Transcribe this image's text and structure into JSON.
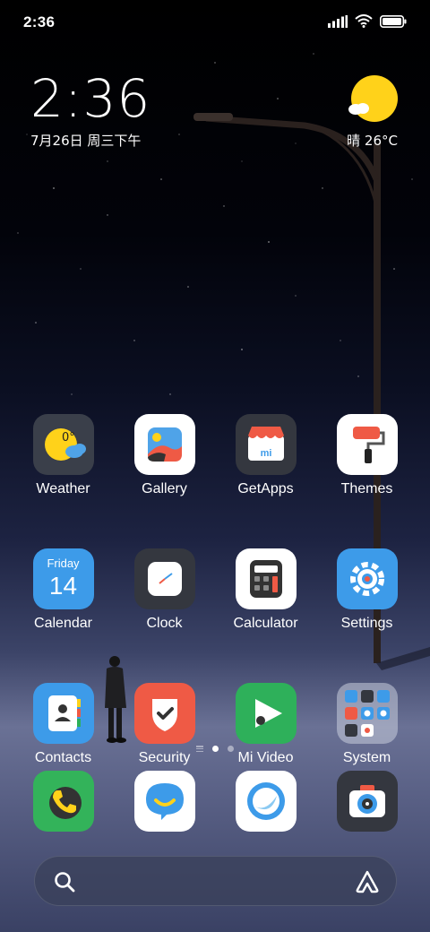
{
  "status_bar": {
    "time": "2:36"
  },
  "clock_widget": {
    "time": "2:36",
    "date": "7月26日 周三下午"
  },
  "weather_widget": {
    "text": "晴 26°C",
    "sun_color": "#ffd21a"
  },
  "apps": [
    {
      "id": "weather",
      "label": "Weather",
      "icon": "weather-icon",
      "badge_text": "0°"
    },
    {
      "id": "gallery",
      "label": "Gallery",
      "icon": "gallery-icon"
    },
    {
      "id": "getapps",
      "label": "GetApps",
      "icon": "getapps-icon",
      "badge_text": "mi"
    },
    {
      "id": "themes",
      "label": "Themes",
      "icon": "themes-icon"
    },
    {
      "id": "calendar",
      "label": "Calendar",
      "icon": "calendar-icon",
      "day_name": "Friday",
      "day_number": "14"
    },
    {
      "id": "clock",
      "label": "Clock",
      "icon": "clock-icon"
    },
    {
      "id": "calculator",
      "label": "Calculator",
      "icon": "calculator-icon"
    },
    {
      "id": "settings",
      "label": "Settings",
      "icon": "settings-icon"
    },
    {
      "id": "contacts",
      "label": "Contacts",
      "icon": "contacts-icon"
    },
    {
      "id": "security",
      "label": "Security",
      "icon": "security-icon"
    },
    {
      "id": "mivideo",
      "label": "Mi Video",
      "icon": "mi-video-icon"
    },
    {
      "id": "system",
      "label": "System",
      "icon": "system-folder-icon"
    }
  ],
  "pager": {
    "pages": 2,
    "active_page": 1
  },
  "dock": [
    {
      "id": "phone",
      "icon": "phone-icon"
    },
    {
      "id": "messaging",
      "icon": "messaging-icon"
    },
    {
      "id": "browser",
      "icon": "browser-icon"
    },
    {
      "id": "camera",
      "icon": "camera-icon"
    }
  ],
  "search_bar": {
    "left_icon": "search-icon",
    "right_icon": "assistant-icon"
  },
  "colors": {
    "weather_bg": "#3a3f4a",
    "dark_icon_bg": "#34373f",
    "white_icon_bg": "#ffffff",
    "calendar_blue": "#3d9be9",
    "settings_blue": "#3d9be9",
    "contacts_blue": "#3d9be9",
    "security_red": "#ef5a45",
    "mivideo_green": "#2eb05a",
    "phone_green": "#33b35a"
  }
}
